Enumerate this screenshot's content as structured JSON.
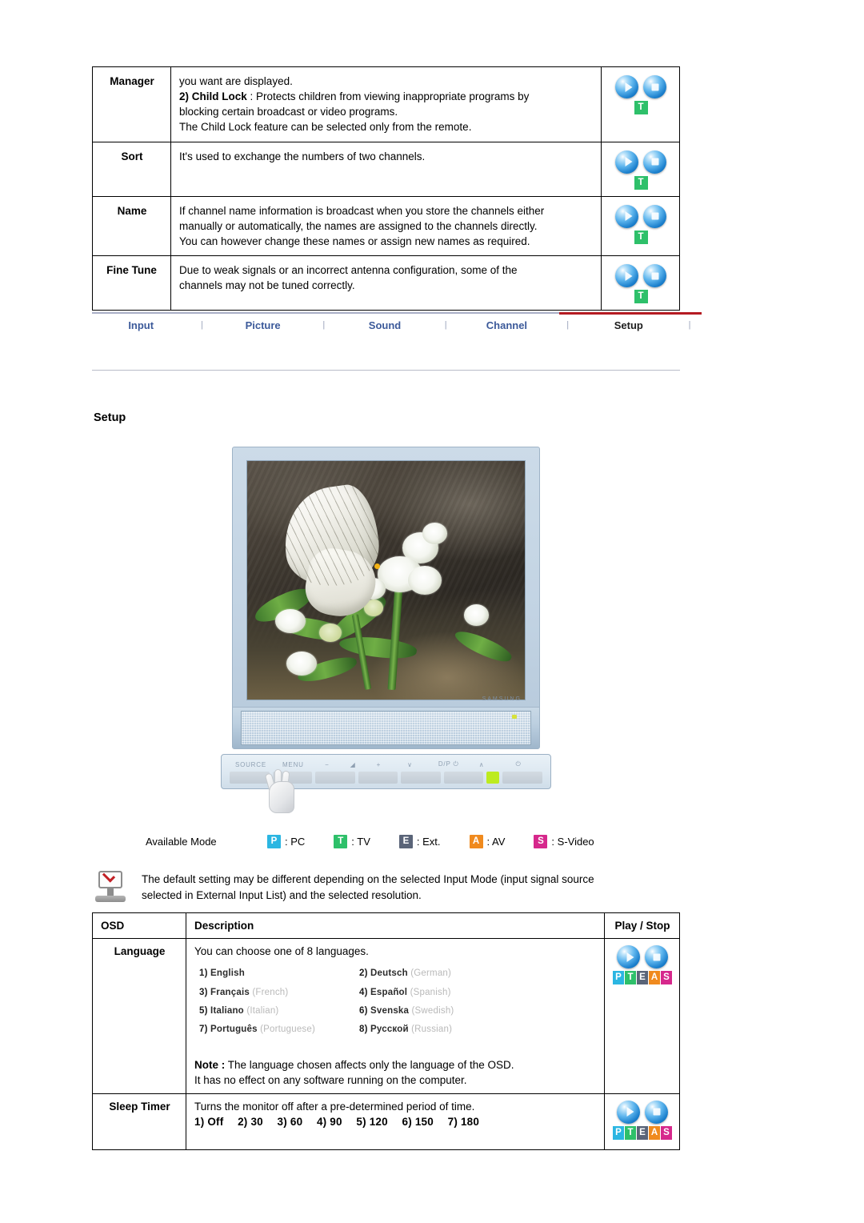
{
  "top_table": {
    "rows": [
      {
        "label": "Manager",
        "lines": [
          "you want are displayed.",
          "2) Child Lock : Protects children from viewing inappropriate programs by",
          "blocking certain broadcast or video programs.",
          "The Child Lock feature can be selected only from the remote."
        ],
        "bold_prefix": "2) Child Lock",
        "play_modes": [
          "T"
        ]
      },
      {
        "label": "Sort",
        "lines": [
          "It's used to exchange the numbers of two channels."
        ],
        "play_modes": [
          "T"
        ]
      },
      {
        "label": "Name",
        "lines": [
          "If channel name information is broadcast when you store the channels either",
          "manually or automatically, the names are assigned to the channels directly.",
          "You can however change these names or assign new names as required."
        ],
        "play_modes": [
          "T"
        ]
      },
      {
        "label": "Fine Tune",
        "lines": [
          "Due to weak signals or an incorrect antenna configuration, some of the",
          "channels may not be tuned correctly."
        ],
        "play_modes": [
          "T"
        ]
      }
    ]
  },
  "nav": {
    "items": [
      {
        "label": "Input",
        "active": false
      },
      {
        "label": "Picture",
        "active": false
      },
      {
        "label": "Sound",
        "active": false
      },
      {
        "label": "Channel",
        "active": false
      },
      {
        "label": "Setup",
        "active": true
      }
    ],
    "separator": "|",
    "active_underline_color": "#b51b22"
  },
  "section": {
    "heading": "Setup"
  },
  "monitor": {
    "buttons": [
      "SOURCE",
      "MENU",
      "−",
      "◢",
      "+",
      "∨",
      "D/P ⏻",
      "∧",
      "⏻"
    ],
    "brand_mark": "SAMSUNG",
    "led_color": "#bdeb1f"
  },
  "available_mode": {
    "label": "Available Mode",
    "items": [
      {
        "badge": "P",
        "color": "#2bb6e2",
        "text": ": PC"
      },
      {
        "badge": "T",
        "color": "#2ec06a",
        "text": ": TV"
      },
      {
        "badge": "E",
        "color": "#5a6478",
        "text": ": Ext."
      },
      {
        "badge": "A",
        "color": "#f08a1e",
        "text": ": AV"
      },
      {
        "badge": "S",
        "color": "#d6288c",
        "text": ": S-Video"
      }
    ]
  },
  "note": {
    "icon": "monitor-check-icon",
    "lines": [
      "The default setting may be different depending on the selected Input Mode (input signal source",
      "selected in External Input List) and the selected resolution."
    ]
  },
  "bottom_table": {
    "headers": {
      "osd": "OSD",
      "description": "Description",
      "play_stop": "Play / Stop"
    },
    "language_row": {
      "label": "Language",
      "intro": "You can choose one of 8 languages.",
      "languages": [
        {
          "num": "1)",
          "name": "English",
          "english": ""
        },
        {
          "num": "2)",
          "name": "Deutsch",
          "english": "(German)"
        },
        {
          "num": "3)",
          "name": "Français",
          "english": "(French)"
        },
        {
          "num": "4)",
          "name": "Español",
          "english": "(Spanish)"
        },
        {
          "num": "5)",
          "name": "Italiano",
          "english": "(Italian)"
        },
        {
          "num": "6)",
          "name": "Svenska",
          "english": "(Swedish)"
        },
        {
          "num": "7)",
          "name": "Português",
          "english": "(Portuguese)"
        },
        {
          "num": "8)",
          "name": "Русской",
          "english": "(Russian)"
        }
      ],
      "note_bold": "Note :",
      "note_rest": " The language chosen affects only the language of the OSD.",
      "note_line2": "It has no effect on any software running on the computer.",
      "play_modes": [
        "P",
        "T",
        "E",
        "A",
        "S"
      ]
    },
    "sleep_timer_row": {
      "label": "Sleep Timer",
      "description": "Turns the monitor off after a pre-determined period of time.",
      "values": "1) Off  2) 30  3) 60  4) 90  5) 120  6) 150  7) 180",
      "play_modes": [
        "P",
        "T",
        "E",
        "A",
        "S"
      ]
    }
  }
}
